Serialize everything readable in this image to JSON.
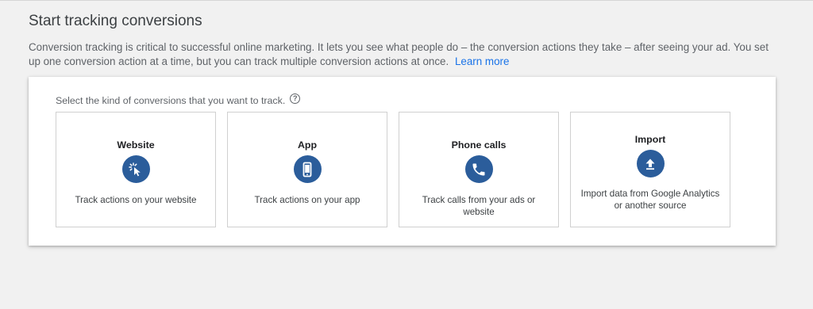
{
  "header": {
    "title": "Start tracking conversions",
    "intro": "Conversion tracking is critical to successful online marketing. It lets you see what people do – the conversion actions they take – after seeing your ad. You set up one conversion action at a time, but you can track multiple conversion actions at once.",
    "learn_more": "Learn more"
  },
  "panel": {
    "prompt": "Select the kind of conversions that you want to track.",
    "help_icon": "question-circle-icon",
    "icon_color": "#2b5d9b",
    "link_color": "#1a73e8",
    "cards": [
      {
        "title": "Website",
        "icon": "cursor-click-icon",
        "description": "Track actions on your website"
      },
      {
        "title": "App",
        "icon": "mobile-phone-icon",
        "description": "Track actions on your app"
      },
      {
        "title": "Phone calls",
        "icon": "phone-icon",
        "description": "Track calls from your ads or website"
      },
      {
        "title": "Import",
        "icon": "upload-icon",
        "description": "Import data from Google Analytics or another source"
      }
    ]
  }
}
